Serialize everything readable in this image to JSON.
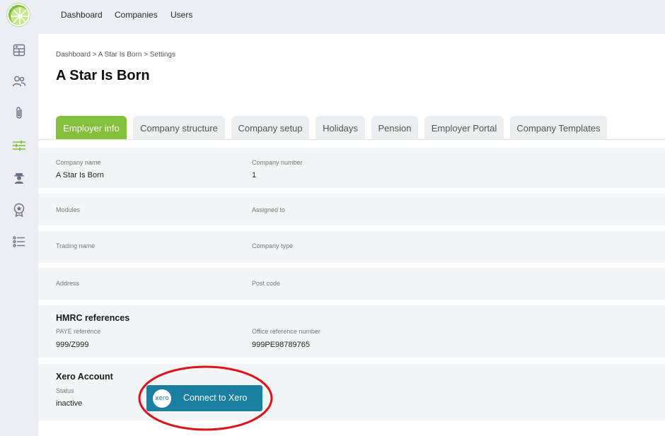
{
  "nav": {
    "items": [
      "Dashboard",
      "Companies",
      "Users"
    ]
  },
  "sidebar": {
    "icons": [
      "dashboard-grid-icon",
      "people-icon",
      "paperclip-icon",
      "sliders-icon",
      "person-hat-icon",
      "award-badge-icon",
      "checklist-icon"
    ],
    "active_icon": "sliders-icon"
  },
  "breadcrumb": "Dashboard > A Star Is Born > Settings",
  "page_title": "A Star Is Born",
  "tabs": [
    "Employer info",
    "Company structure",
    "Company setup",
    "Holidays",
    "Pension",
    "Employer Portal",
    "Company Templates"
  ],
  "active_tab": "Employer info",
  "fields": {
    "company_name": {
      "label": "Company name",
      "value": "A Star Is Born"
    },
    "company_number": {
      "label": "Company number",
      "value": "1"
    },
    "modules": {
      "label": "Modules",
      "value": ""
    },
    "assigned_to": {
      "label": "Assigned to",
      "value": ""
    },
    "trading_name": {
      "label": "Trading name",
      "value": ""
    },
    "company_type": {
      "label": "Company type",
      "value": ""
    },
    "address": {
      "label": "Address",
      "value": ""
    },
    "post_code": {
      "label": "Post code",
      "value": ""
    }
  },
  "hmrc": {
    "title": "HMRC references",
    "paye_label": "PAYE reference",
    "paye_value": "999/Z999",
    "office_label": "Office reference number",
    "office_value": "999PE98789765"
  },
  "xero": {
    "title": "Xero Account",
    "status_label": "Status",
    "status_value": "inactive",
    "logo_text": "xero",
    "button_label": "Connect to Xero"
  },
  "colors": {
    "accent_green": "#84c03b",
    "xero_blue": "#1b7fa2",
    "highlight_red": "#d9141b",
    "sidebar_bg": "#eceef3"
  }
}
